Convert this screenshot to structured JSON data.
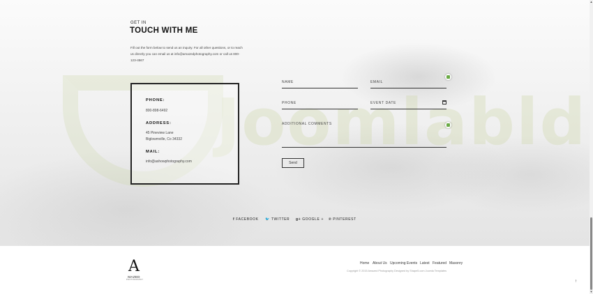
{
  "header": {
    "eyebrow": "GET IN",
    "title": "TOUCH WITH ME"
  },
  "intro": "Fill out the form below to send us an inquiry. For all other questions, or to reach us directly you can email us at info@amazedphotography.com or call us 800-123-4567",
  "contact": {
    "phone_label": "PHONE:",
    "phone_value": "800-898-6492",
    "address_label": "ADDRESS:",
    "address_line1": "45 Pineview Lane",
    "address_line2": "Biglowmville, Co 34332",
    "mail_label": "MAIL:",
    "mail_value": "info@ashowphotography.com"
  },
  "form": {
    "name_label": "NAME",
    "email_label": "EMAIL",
    "phone_label": "PHONE",
    "date_label": "EVENT DATE",
    "comments_label": "ADDITIONAL COMMENTS",
    "send_label": "Send"
  },
  "watermark": "Joomlabld",
  "social": [
    {
      "icon": "f",
      "label": "FACEBOOK"
    },
    {
      "icon": "🐦",
      "label": "TWITTER"
    },
    {
      "icon": "g+",
      "label": "GOOGLE +"
    },
    {
      "icon": "℗",
      "label": "PINTEREST"
    }
  ],
  "footer": {
    "logo_letter": "A",
    "logo_name": "MAZED",
    "logo_sub": "PHOTOGRAPHY",
    "nav": [
      "Home",
      "About Us",
      "Upcoming Events",
      "Latest",
      "Featured",
      "Masonry"
    ],
    "copyright": "Copyright © 2015 Amazed Photography Designed by Shape5.com Joomla Templates",
    "to_top": "↑"
  },
  "colors": {
    "accent_green": "#6aaa45",
    "text_dark": "#111111"
  }
}
